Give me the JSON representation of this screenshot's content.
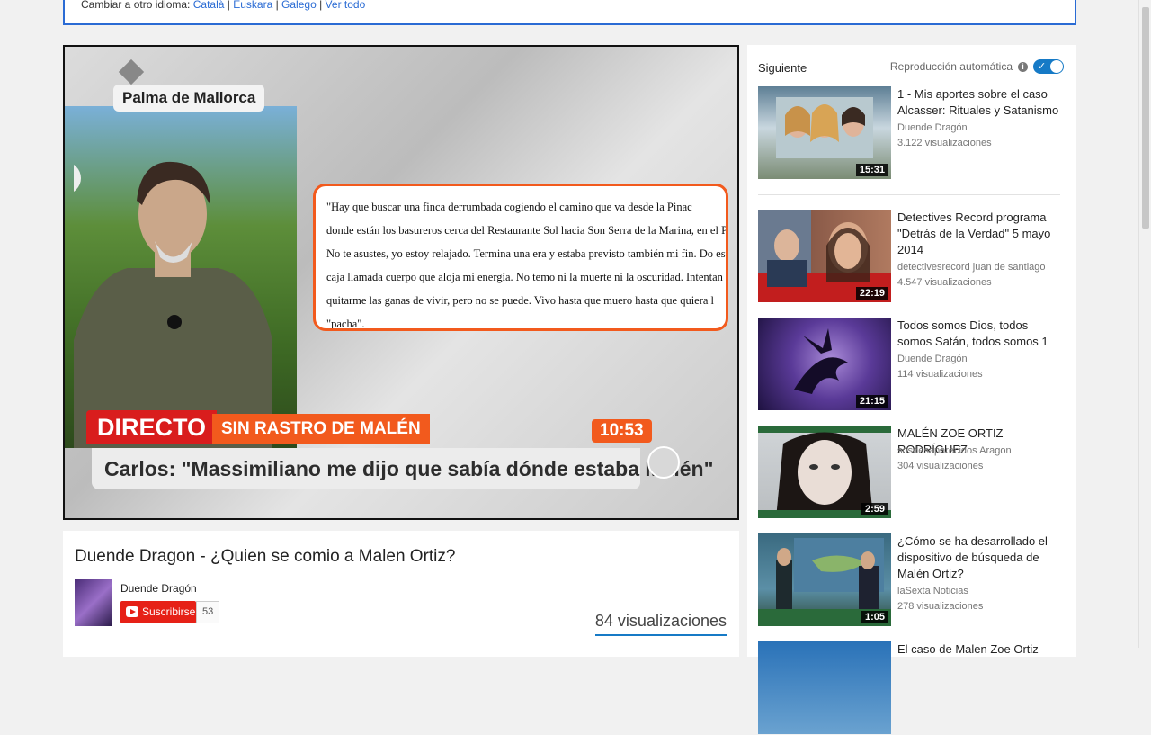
{
  "lang_bar": {
    "prefix": "Cambiar a otro idioma:",
    "links": [
      "Català",
      "Euskara",
      "Galego",
      "Ver todo"
    ]
  },
  "video": {
    "location": "Palma de Mallorca",
    "quote_lines": [
      "     \"Hay que buscar una finca derrumbada cogiendo el camino que va desde la Pinac",
      "donde están los basureros cerca del Restaurante Sol hacia Son Serra de la Marina, en el Poz",
      "No te asustes, yo estoy relajado. Termina una era y estaba previsto también mi fin. Do est",
      "caja llamada cuerpo que aloja mi energía. No temo ni la muerte ni la oscuridad. Intentan d",
      "quitarme las ganas de vivir, pero no se puede. Vivo hasta que muero hasta que quiera l",
      "\"pacha\"."
    ],
    "directo": "DIRECTO",
    "rastro": "SIN RASTRO DE MALÉN",
    "clock": "10:53",
    "headline": "Carlos: \"Massimiliano me dijo que sabía dónde estaba Malén\""
  },
  "info": {
    "title": "Duende Dragon - ¿Quien se comio a Malen Ortiz?",
    "channel": "Duende Dragón",
    "subscribe_label": "Suscribirse",
    "sub_count": "53",
    "views": "84 visualizaciones"
  },
  "sidebar": {
    "next_label": "Siguiente",
    "autoplay_label": "Reproducción automática",
    "items": [
      {
        "title": "1 - Mis aportes sobre el caso Alcasser: Rituales y Satanismo",
        "channel": "Duende Dragón",
        "views": "3.122 visualizaciones",
        "duration": "15:31"
      },
      {
        "title": "Detectives Record programa \"Detrás de la Verdad\" 5 mayo 2014",
        "channel": "detectivesrecord juan de santiago",
        "views": "4.547 visualizaciones",
        "duration": "22:19"
      },
      {
        "title": "Todos somos Dios, todos somos Satán, todos somos 1",
        "channel": "Duende Dragón",
        "views": "114 visualizaciones",
        "duration": "21:15"
      },
      {
        "title": "MALÉN ZOE ORTIZ RODRÍGUEZ",
        "channel": "sosdesaparecidos Aragon",
        "views": "304 visualizaciones",
        "duration": "2:59"
      },
      {
        "title": "¿Cómo se ha desarrollado el dispositivo de búsqueda de Malén Ortiz?",
        "channel": "laSexta Noticias",
        "views": "278 visualizaciones",
        "duration": "1:05"
      },
      {
        "title": "El caso de Malen Zoe Ortiz",
        "channel": "",
        "views": "",
        "duration": ""
      }
    ]
  }
}
